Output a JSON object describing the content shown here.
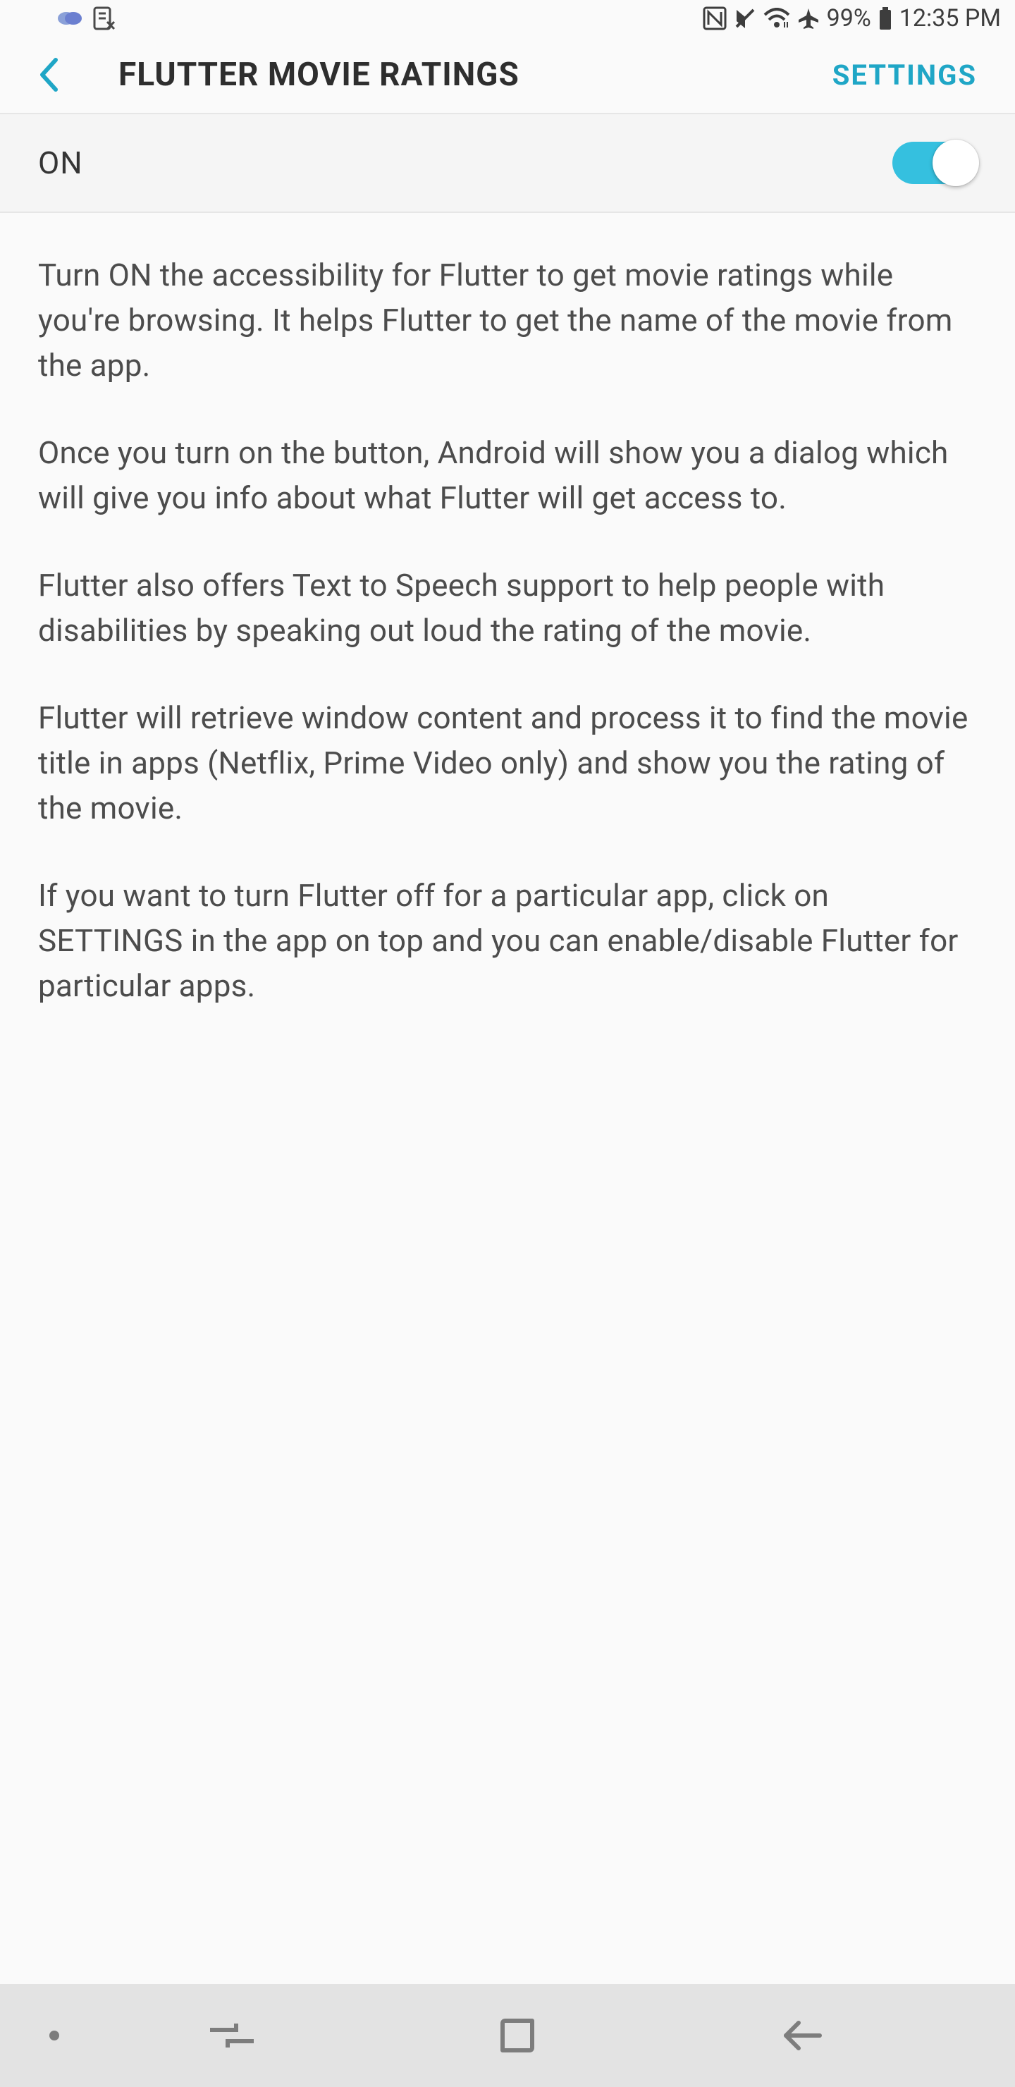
{
  "status_bar": {
    "battery_percent": "99%",
    "time": "12:35 PM"
  },
  "header": {
    "title": "FLUTTER MOVIE RATINGS",
    "action": "SETTINGS"
  },
  "toggle": {
    "state_label": "ON",
    "enabled": true
  },
  "description": {
    "paragraphs": [
      "Turn ON the accessibility for Flutter to get movie ratings while you're browsing. It helps Flutter to get the name of the movie from the app.",
      "Once you turn on the button, Android will show you a dialog which will give you info about what Flutter will get access to.",
      "Flutter also offers Text to Speech support to help people with disabilities by speaking out loud the rating of the movie.",
      "Flutter will retrieve window content and process it to find the movie title in apps (Netflix, Prime Video only) and show you the rating of the movie.",
      "If you want to turn Flutter off for a particular app, click on SETTINGS in the app on top and you can enable/disable Flutter for particular apps."
    ]
  }
}
